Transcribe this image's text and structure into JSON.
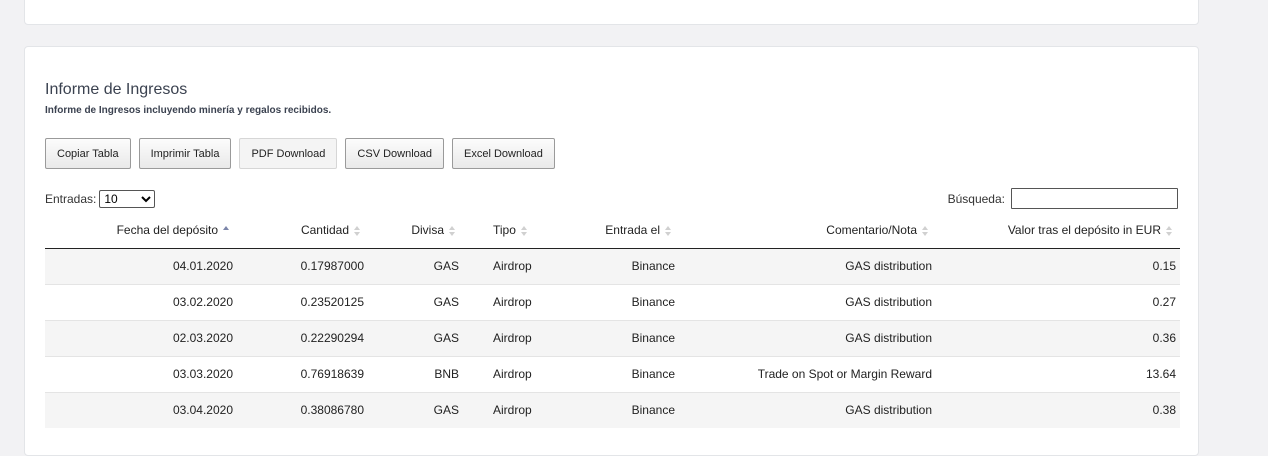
{
  "report": {
    "title": "Informe de Ingresos",
    "subtitle": "Informe de Ingresos incluyendo minería y regalos recibidos."
  },
  "buttons": {
    "copy": "Copiar Tabla",
    "print": "Imprimir Tabla",
    "pdf": "PDF Download",
    "csv": "CSV Download",
    "excel": "Excel Download"
  },
  "length": {
    "label": "Entradas:",
    "value": "10"
  },
  "search": {
    "label": "Búsqueda:",
    "value": ""
  },
  "table": {
    "headers": [
      "Fecha del depósito",
      "Cantidad",
      "Divisa",
      "Tipo",
      "Entrada el",
      "Comentario/Nota",
      "Valor tras el depósito in EUR"
    ],
    "rows": [
      [
        "04.01.2020",
        "0.17987000",
        "GAS",
        "Airdrop",
        "Binance",
        "GAS distribution",
        "0.15"
      ],
      [
        "03.02.2020",
        "0.23520125",
        "GAS",
        "Airdrop",
        "Binance",
        "GAS distribution",
        "0.27"
      ],
      [
        "02.03.2020",
        "0.22290294",
        "GAS",
        "Airdrop",
        "Binance",
        "GAS distribution",
        "0.36"
      ],
      [
        "03.03.2020",
        "0.76918639",
        "BNB",
        "Airdrop",
        "Binance",
        "Trade on Spot or Margin Reward",
        "13.64"
      ],
      [
        "03.04.2020",
        "0.38086780",
        "GAS",
        "Airdrop",
        "Binance",
        "GAS distribution",
        "0.38"
      ]
    ]
  },
  "colors": {
    "sort_active": "#7b85a9",
    "sort_inactive": "#d0d0d0",
    "stripe": "#f5f5f5"
  }
}
